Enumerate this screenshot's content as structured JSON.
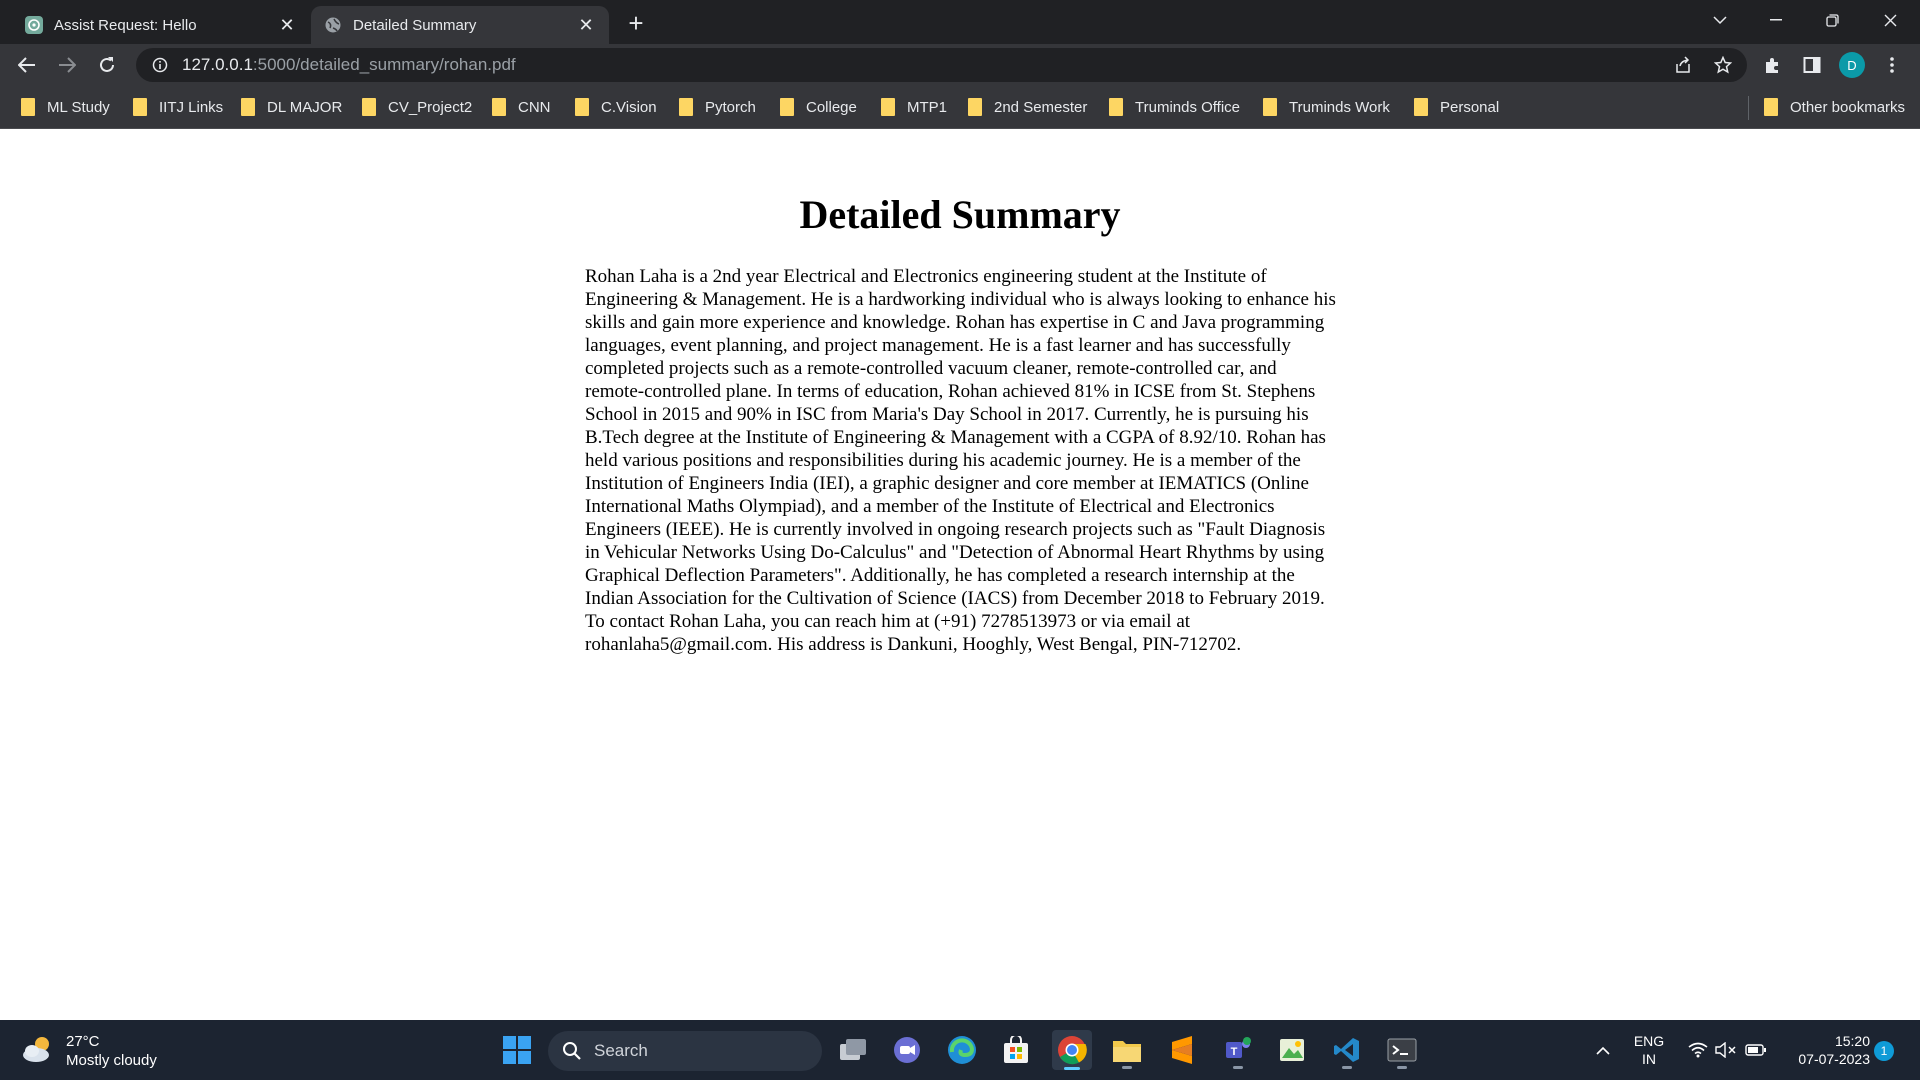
{
  "browser": {
    "tabs": [
      {
        "title": "Assist Request: Hello",
        "icon": "chatgpt-icon",
        "active": false
      },
      {
        "title": "Detailed Summary",
        "icon": "globe-icon",
        "active": true
      }
    ],
    "address_bar": {
      "host": "127.0.0.1",
      "path": ":5000/detailed_summary/rohan.pdf"
    },
    "profile_initial": "D",
    "bookmarks": [
      "ML Study",
      "IITJ Links",
      "DL MAJOR",
      "CV_Project2",
      "CNN",
      "C.Vision",
      "Pytorch",
      "College",
      "MTP1",
      "2nd Semester",
      "Truminds Office",
      "Truminds Work",
      "Personal"
    ],
    "other_bookmarks": "Other bookmarks"
  },
  "page": {
    "heading": "Detailed Summary",
    "summary": "Rohan Laha is a 2nd year Electrical and Electronics engineering student at the Institute of Engineering & Management. He is a hardworking individual who is always looking to enhance his skills and gain more experience and knowledge. Rohan has expertise in C and Java programming languages, event planning, and project management. He is a fast learner and has successfully completed projects such as a remote-controlled vacuum cleaner, remote-controlled car, and remote-controlled plane. In terms of education, Rohan achieved 81% in ICSE from St. Stephens School in 2015 and 90% in ISC from Maria's Day School in 2017. Currently, he is pursuing his B.Tech degree at the Institute of Engineering & Management with a CGPA of 8.92/10. Rohan has held various positions and responsibilities during his academic journey. He is a member of the Institution of Engineers India (IEI), a graphic designer and core member at IEMATICS (Online International Maths Olympiad), and a member of the Institute of Electrical and Electronics Engineers (IEEE). He is currently involved in ongoing research projects such as \"Fault Diagnosis in Vehicular Networks Using Do-Calculus\" and \"Detection of Abnormal Heart Rhythms by using Graphical Deflection Parameters\". Additionally, he has completed a research internship at the Indian Association for the Cultivation of Science (IACS) from December 2018 to February 2019. To contact Rohan Laha, you can reach him at (+91) 7278513973 or via email at rohanlaha5@gmail.com. His address is Dankuni, Hooghly, West Bengal, PIN-712702."
  },
  "taskbar": {
    "weather": {
      "temp": "27°C",
      "condition": "Mostly cloudy"
    },
    "search_label": "Search",
    "language": {
      "line1": "ENG",
      "line2": "IN"
    },
    "clock": {
      "time": "15:20",
      "date": "07-07-2023"
    },
    "notification_count": "1"
  }
}
